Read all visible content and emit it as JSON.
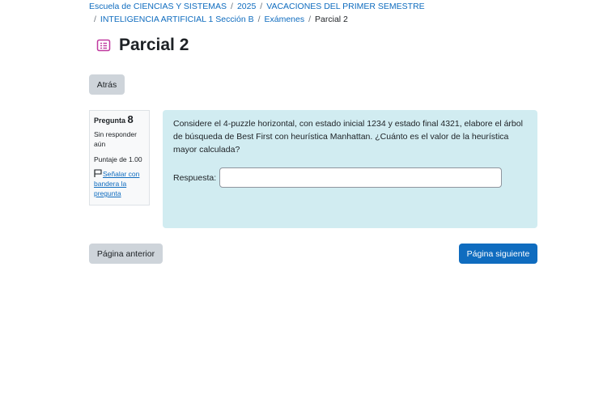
{
  "breadcrumb": {
    "items": [
      "Escuela de CIENCIAS Y SISTEMAS",
      "2025",
      "VACACIONES DEL PRIMER SEMESTRE",
      "INTELIGENCIA ARTIFICIAL 1 Sección B",
      "Exámenes"
    ],
    "current": "Parcial 2",
    "separator": "/"
  },
  "header": {
    "title": "Parcial 2",
    "icon": "quiz-icon",
    "icon_color": "#c0399f"
  },
  "back_button": {
    "label": "Atrás"
  },
  "question_info": {
    "label": "Pregunta",
    "number": "8",
    "state": "Sin responder aún",
    "grade": "Puntaje de 1.00",
    "flag_label": "Señalar con bandera la pregunta",
    "flag_icon": "flag-icon"
  },
  "question": {
    "text": "Considere el 4-puzzle horizontal, con estado inicial 1234 y estado final 4321, elabore el árbol de búsqueda de Best First con heurística Manhattan. ¿Cuánto es el valor de la heurística mayor calculada?",
    "answer_label": "Respuesta:",
    "answer_value": "",
    "background": "#d1ecf1"
  },
  "navigation": {
    "prev_label": "Página anterior",
    "next_label": "Página siguiente"
  },
  "colors": {
    "link": "#0f6cbf",
    "primary": "#0f6cbf",
    "secondary": "#ced4da"
  }
}
